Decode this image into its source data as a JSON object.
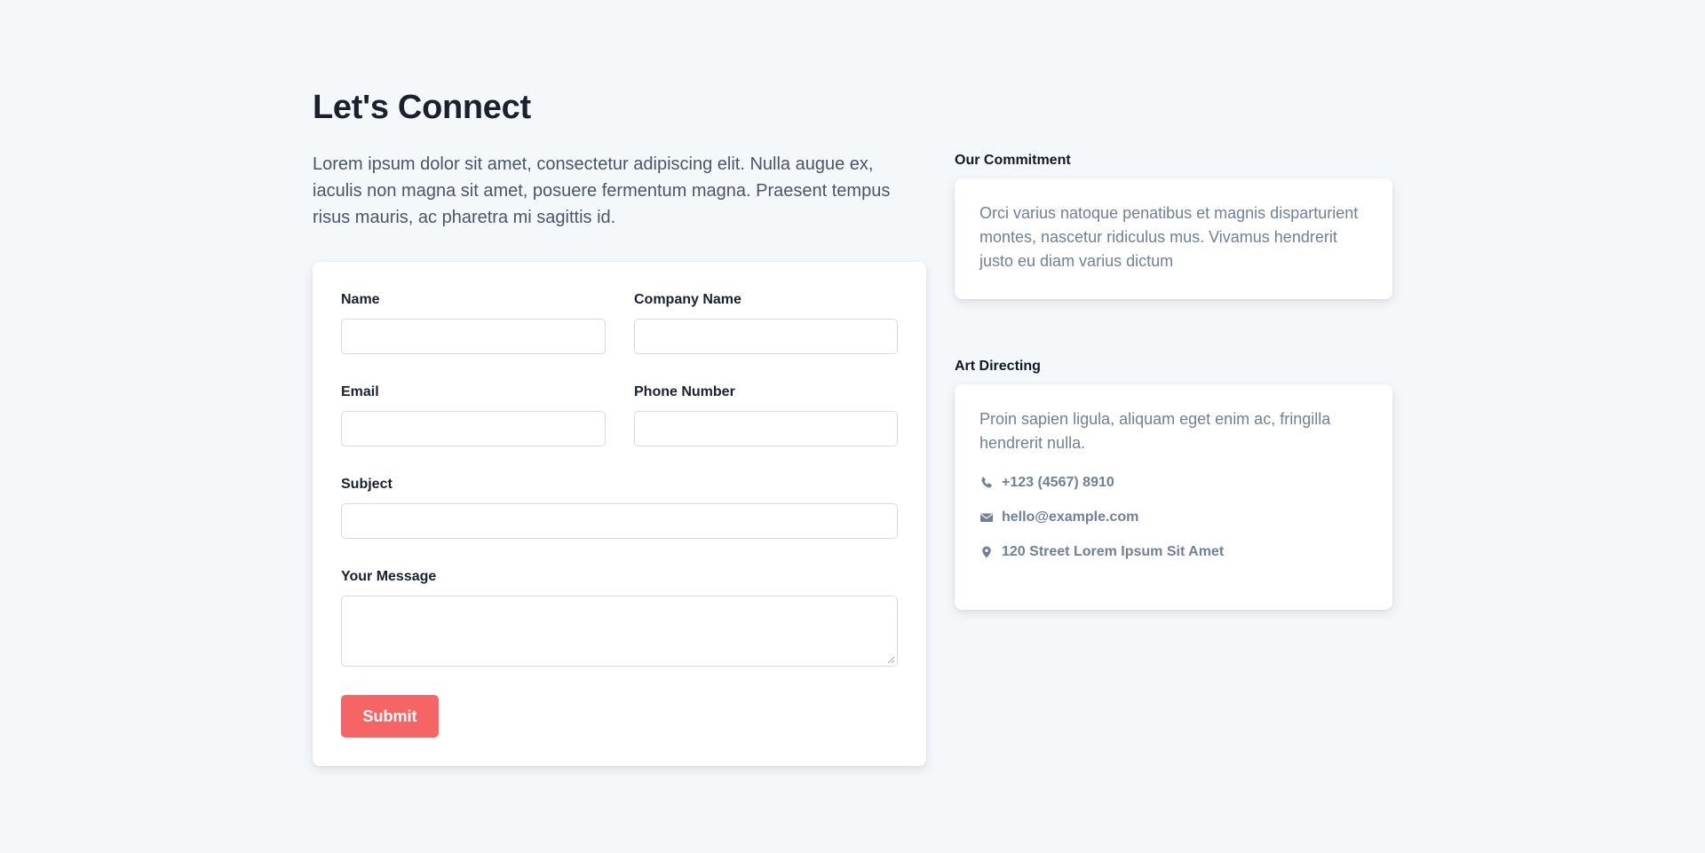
{
  "header": {
    "title": "Let's Connect",
    "intro": "Lorem ipsum dolor sit amet, consectetur adipiscing elit. Nulla augue ex, iaculis non magna sit amet, posuere fermentum magna. Praesent tempus risus mauris, ac pharetra mi sagittis id."
  },
  "form": {
    "name_label": "Name",
    "name_value": "",
    "company_label": "Company Name",
    "company_value": "",
    "email_label": "Email",
    "email_value": "",
    "phone_label": "Phone Number",
    "phone_value": "",
    "subject_label": "Subject",
    "subject_value": "",
    "message_label": "Your Message",
    "message_value": "",
    "submit_label": "Submit"
  },
  "commitment": {
    "heading": "Our Commitment",
    "text": "Orci varius natoque penatibus et magnis disparturient montes, nascetur ridiculus mus. Vivamus hendrerit justo eu diam varius dictum"
  },
  "art_directing": {
    "heading": "Art Directing",
    "text": "Proin sapien ligula, aliquam eget enim ac, fringilla hendrerit nulla.",
    "contacts": [
      {
        "icon": "phone-icon",
        "text": "+123 (4567) 8910"
      },
      {
        "icon": "envelope-icon",
        "text": "hello@example.com"
      },
      {
        "icon": "map-pin-icon",
        "text": "120 Street Lorem Ipsum Sit Amet"
      }
    ]
  },
  "colors": {
    "background": "#f5f8fb",
    "accent": "#f56565",
    "heading": "#1a202c",
    "muted_text": "#718096"
  }
}
